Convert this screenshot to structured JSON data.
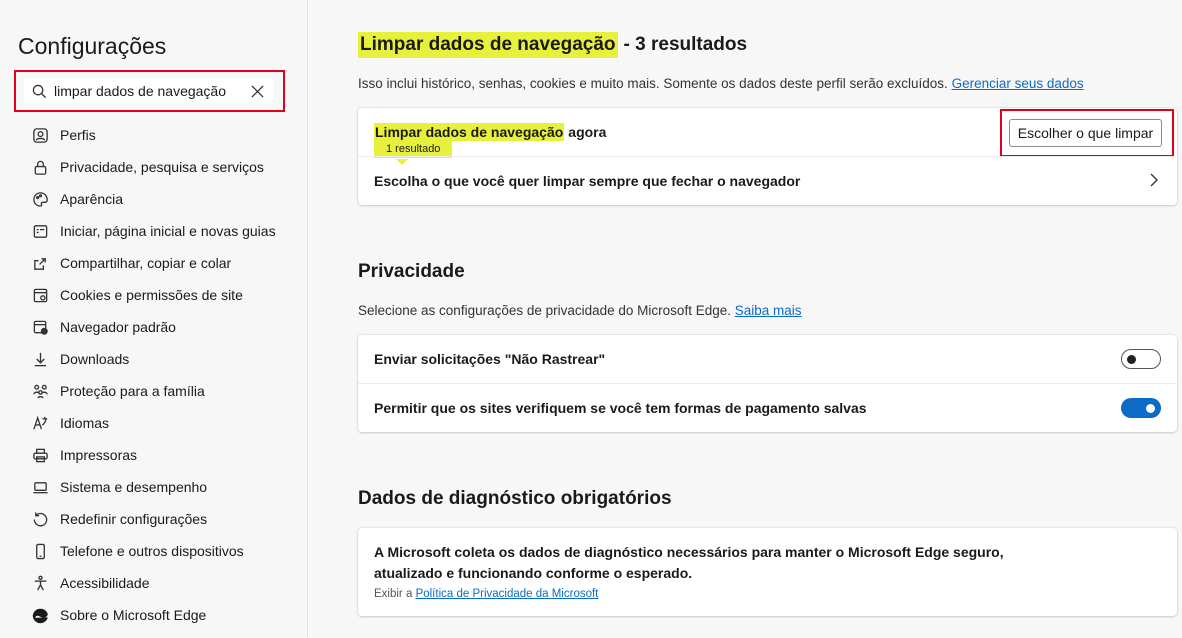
{
  "sidebar": {
    "title": "Configurações",
    "search": {
      "value": "limpar dados de navegação",
      "placeholder": ""
    },
    "items": [
      {
        "label": "Perfis",
        "icon": "profile-icon"
      },
      {
        "label": "Privacidade, pesquisa e serviços",
        "icon": "lock-icon"
      },
      {
        "label": "Aparência",
        "icon": "palette-icon"
      },
      {
        "label": "Iniciar, página inicial e novas guias",
        "icon": "home-grid-icon"
      },
      {
        "label": "Compartilhar, copiar e colar",
        "icon": "share-icon"
      },
      {
        "label": "Cookies e permissões de site",
        "icon": "cookie-settings-icon"
      },
      {
        "label": "Navegador padrão",
        "icon": "default-browser-icon"
      },
      {
        "label": "Downloads",
        "icon": "download-icon"
      },
      {
        "label": "Proteção para a família",
        "icon": "family-icon"
      },
      {
        "label": "Idiomas",
        "icon": "language-icon"
      },
      {
        "label": "Impressoras",
        "icon": "printer-icon"
      },
      {
        "label": "Sistema e desempenho",
        "icon": "laptop-icon"
      },
      {
        "label": "Redefinir configurações",
        "icon": "reset-icon"
      },
      {
        "label": "Telefone e outros dispositivos",
        "icon": "phone-icon"
      },
      {
        "label": "Acessibilidade",
        "icon": "accessibility-icon"
      },
      {
        "label": "Sobre o Microsoft Edge",
        "icon": "edge-logo-icon"
      }
    ]
  },
  "clear_section": {
    "title_highlight": "Limpar dados de navegação",
    "title_rest": "- 3 resultados",
    "description": "Isso inclui histórico, senhas, cookies e muito mais. Somente os dados deste perfil serão excluídos.",
    "manage_link": "Gerenciar seus dados",
    "row1_highlight": "Limpar dados de navegação",
    "row1_rest": "agora",
    "tooltip": "1 resultado",
    "choose_button": "Escolher o que limpar",
    "row2_label": "Escolha o que você quer limpar sempre que fechar o navegador"
  },
  "privacy": {
    "title": "Privacidade",
    "description": "Selecione as configurações de privacidade do Microsoft Edge.",
    "learn_more": "Saiba mais",
    "dnt_label": "Enviar solicitações \"Não Rastrear\"",
    "dnt_on": false,
    "payment_label": "Permitir que os sites verifiquem se você tem formas de pagamento salvas",
    "payment_on": true
  },
  "diagnostics": {
    "title": "Dados de diagnóstico obrigatórios",
    "text": "A Microsoft coleta os dados de diagnóstico necessários para manter o Microsoft Edge seguro, atualizado e funcionando conforme o esperado.",
    "small_prefix": "Exibir a",
    "policy_link": "Política de Privacidade da Microsoft"
  },
  "colors": {
    "highlight": "#e7f03a",
    "accent": "#0b6bc7",
    "red_outline": "#e0001b"
  }
}
